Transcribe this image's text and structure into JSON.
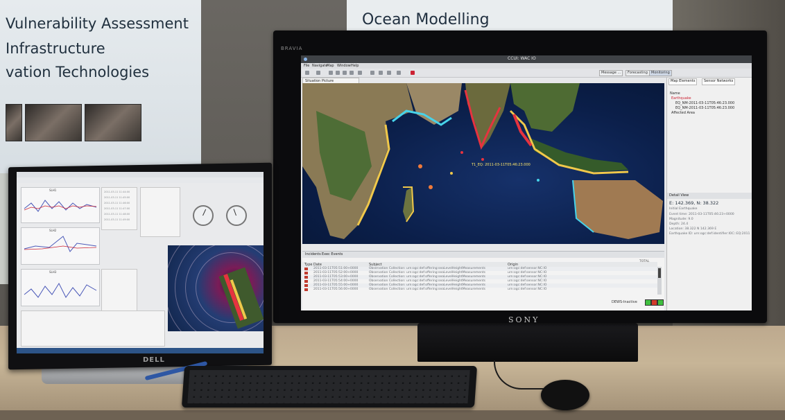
{
  "poster_left": {
    "lines": [
      "Vulnerability Assessment",
      "Infrastructure",
      "vation Technologies"
    ]
  },
  "poster_right": {
    "title": "Ocean Modelling"
  },
  "tv": {
    "brand": "BRAVIA",
    "logo": "SONY",
    "app": {
      "title": "CCUI: WAC IO",
      "menu": [
        "File",
        "Navigate",
        "Map",
        "Window",
        "Help"
      ],
      "perspectives": [
        "Message ...",
        "Forecasting",
        "Monitoring"
      ],
      "editor_tab": "Situation Picture",
      "map_label": "T1_EQ: 2011-03-11T05:46:23.000",
      "side_tabs": [
        "Map Elements",
        "Sensor Networks"
      ],
      "tree": [
        "Name",
        "Earthquake",
        "EQ_NM-2011-03-11T05:46:23.000",
        "EQ_NM-2011-03-11T05:46:23.000",
        "Affected Area"
      ],
      "detail_view_label": "Detail View",
      "detail_title": "E: 142.369, N: 38.322",
      "detail_rows": [
        "Initial Earthquake",
        "Event time:  2011-03-11T05:46:23+0000",
        "Magnitude:  9.0",
        "Depth:  24.4",
        "Location:  38.322 N 142.369 E",
        "Earthquake ID:  urn:ogc:def:identifier:IOC::EQ:2011"
      ],
      "events_tabs": [
        "Incidents",
        "Exec Events"
      ],
      "events_columns": [
        "Type",
        "Date",
        "Subject",
        "Origin"
      ],
      "events_rows": [
        [
          "2011-03-11T05:51:00+0000",
          "Observation Collection: urn:ogc:def:offering:seaLevelHeightMeasurements",
          "urn:ogc:def:sensor:NC:IO"
        ],
        [
          "2011-03-11T05:52:00+0000",
          "Observation Collection: urn:ogc:def:offering:seaLevelHeightMeasurements",
          "urn:ogc:def:sensor:NC:IO"
        ],
        [
          "2011-03-11T05:53:00+0000",
          "Observation Collection: urn:ogc:def:offering:seaLevelHeightMeasurements",
          "urn:ogc:def:sensor:NC:IO"
        ],
        [
          "2011-03-11T05:54:00+0000",
          "Observation Collection: urn:ogc:def:offering:seaLevelHeightMeasurements",
          "urn:ogc:def:sensor:NC:IO"
        ],
        [
          "2011-03-11T05:55:00+0000",
          "Observation Collection: urn:ogc:def:offering:seaLevelHeightMeasurements",
          "urn:ogc:def:sensor:NC:IO"
        ],
        [
          "2011-03-11T05:56:00+0000",
          "Observation Collection: urn:ogc:def:offering:seaLevelHeightMeasurements",
          "urn:ogc:def:sensor:NC:IO"
        ]
      ],
      "total_label": "TOTAL",
      "status_label": "DEWS-Inactive",
      "status_colors": [
        "#3fbf3f",
        "#d23a2a",
        "#3fbf3f"
      ]
    }
  },
  "dell": {
    "logo": "DELL",
    "chart_titles": [
      "SLH1",
      "SLH2",
      "SLH3"
    ],
    "table_rows": [
      "2011-03-11 11:44:00",
      "2011-03-11 11:45:00",
      "2011-03-11 11:46:00",
      "2011-03-11 11:47:00",
      "2011-03-11 11:48:00",
      "2011-03-11 11:49:00"
    ]
  },
  "colors": {
    "wall": "#5d5a55",
    "ocean": "#0b1f4a",
    "coast_hazard_red": "#e6333f",
    "coast_hazard_yellow": "#f0c84a",
    "coast_hazard_cyan": "#47d3ea"
  }
}
